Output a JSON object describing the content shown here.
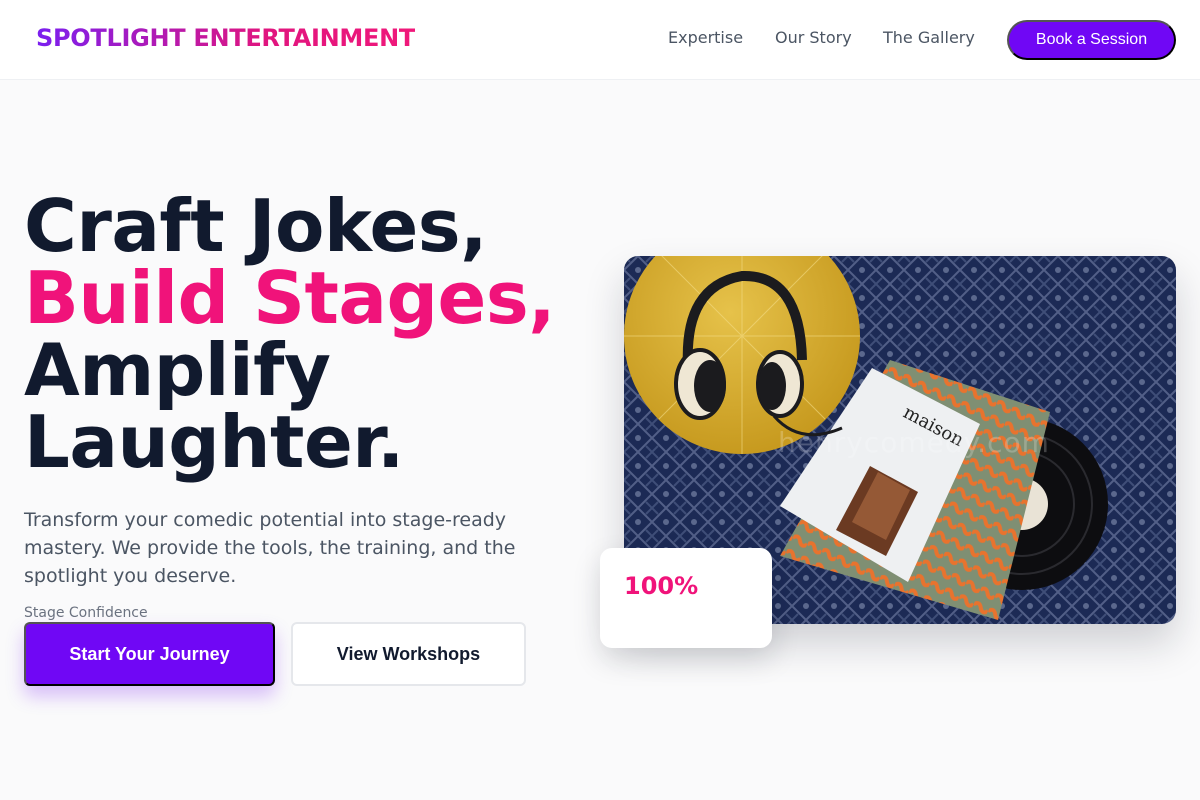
{
  "brand": {
    "logo_text": "SPOTLIGHT ENTERTAINMENT"
  },
  "nav": {
    "items": [
      {
        "label": "Expertise"
      },
      {
        "label": "Our Story"
      },
      {
        "label": "The Gallery"
      }
    ],
    "cta_label": "Book a Session"
  },
  "hero": {
    "headline": {
      "line1": "Craft Jokes,",
      "line2": "Build Stages,",
      "line3": "Amplify",
      "line4": "Laughter."
    },
    "description": "Transform your comedic potential into stage-ready mastery. We provide the tools, the training, and the spotlight you deserve.",
    "primary_button": "Start Your Journey",
    "secondary_button": "View Workshops",
    "image": {
      "watermark": "henrycomedy.com",
      "magazine_title": "maison"
    },
    "stat": {
      "value": "100%",
      "label": "Stage Confidence"
    }
  },
  "colors": {
    "primary": "#7007f5",
    "accent": "#f0137a",
    "heading": "#111a2e",
    "body_text": "#4b5563"
  }
}
